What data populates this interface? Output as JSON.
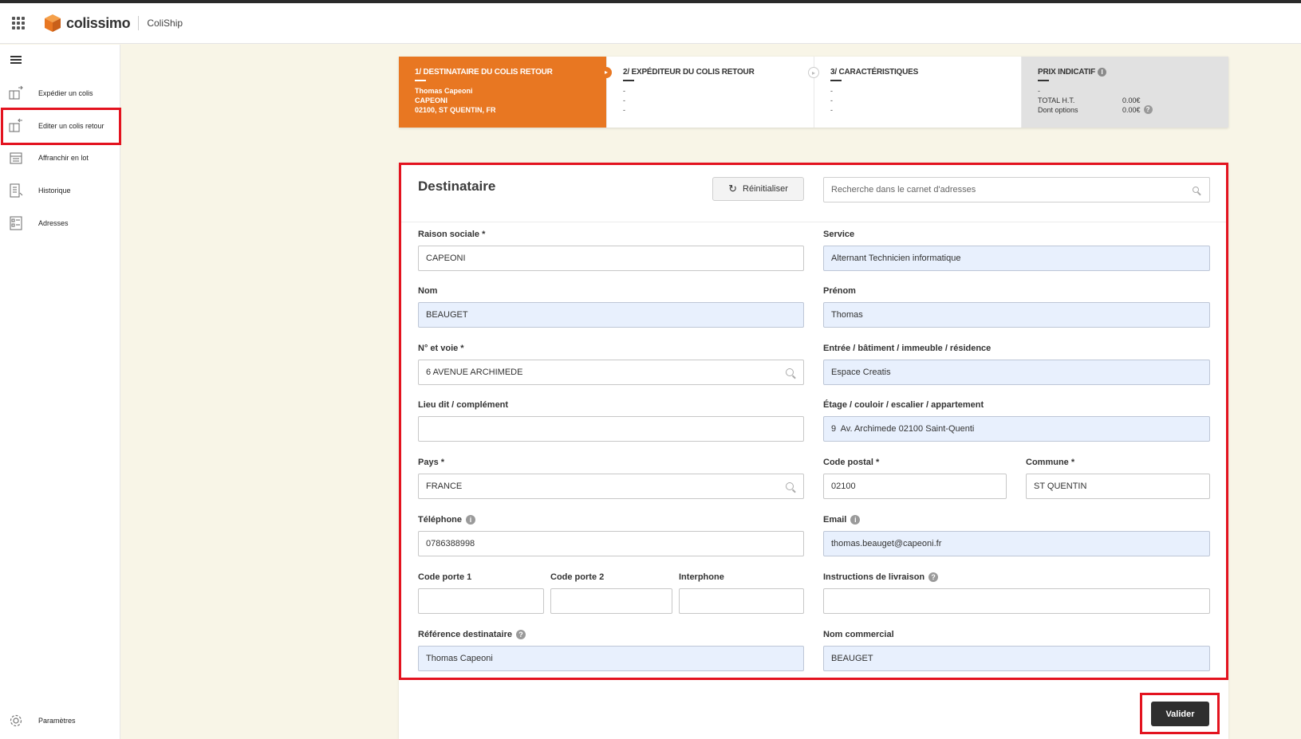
{
  "header": {
    "brand": "colissimo",
    "app_name": "ColiShip"
  },
  "sidebar": {
    "items": [
      {
        "label": "Expédier un colis",
        "icon": "send-parcel-icon"
      },
      {
        "label": "Editer un colis retour",
        "icon": "return-parcel-icon",
        "active": true
      },
      {
        "label": "Affranchir en lot",
        "icon": "batch-postage-icon"
      },
      {
        "label": "Historique",
        "icon": "history-icon"
      },
      {
        "label": "Adresses",
        "icon": "addresses-icon"
      }
    ],
    "settings_label": "Paramètres"
  },
  "stepper": {
    "step1": {
      "title": "1/ DESTINATAIRE DU COLIS RETOUR",
      "lines": [
        "Thomas Capeoni",
        "CAPEONI",
        "02100, ST QUENTIN, FR"
      ]
    },
    "step2": {
      "title": "2/ EXPÉDITEUR DU COLIS RETOUR",
      "lines": [
        "-",
        "-",
        "-"
      ]
    },
    "step3": {
      "title": "3/ CARACTÉRISTIQUES",
      "lines": [
        "-",
        "-",
        "-"
      ]
    },
    "price": {
      "title": "PRIX INDICATIF",
      "dash": "-",
      "total_label": "TOTAL H.T.",
      "total_value": "0.00€",
      "options_label": "Dont options",
      "options_value": "0.00€"
    }
  },
  "form": {
    "title": "Destinataire",
    "reset_label": "Réinitialiser",
    "search_placeholder": "Recherche dans le carnet d'adresses",
    "fields": {
      "raison_sociale": {
        "label": "Raison sociale *",
        "value": "CAPEONI"
      },
      "service": {
        "label": "Service",
        "value": "Alternant Technicien informatique"
      },
      "nom": {
        "label": "Nom",
        "value": "BEAUGET"
      },
      "prenom": {
        "label": "Prénom",
        "value": "Thomas"
      },
      "voie": {
        "label": "N° et voie *",
        "value": "6 AVENUE ARCHIMEDE"
      },
      "entree": {
        "label": "Entrée / bâtiment / immeuble / résidence",
        "value": "Espace Creatis"
      },
      "lieu_dit": {
        "label": "Lieu dit / complément",
        "value": ""
      },
      "etage": {
        "label": "Étage / couloir / escalier / appartement",
        "value": "9  Av. Archimede 02100 Saint-Quenti"
      },
      "pays": {
        "label": "Pays *",
        "value": "FRANCE"
      },
      "code_postal": {
        "label": "Code postal *",
        "value": "02100"
      },
      "commune": {
        "label": "Commune *",
        "value": "ST QUENTIN"
      },
      "telephone": {
        "label": "Téléphone",
        "value": "0786388998"
      },
      "email": {
        "label": "Email",
        "value": "thomas.beauget@capeoni.fr"
      },
      "code_porte_1": {
        "label": "Code porte 1",
        "value": ""
      },
      "code_porte_2": {
        "label": "Code porte 2",
        "value": ""
      },
      "interphone": {
        "label": "Interphone",
        "value": ""
      },
      "instructions": {
        "label": "Instructions de livraison",
        "value": ""
      },
      "reference": {
        "label": "Référence destinataire",
        "value": "Thomas Capeoni"
      },
      "nom_commercial": {
        "label": "Nom commercial",
        "value": "BEAUGET"
      }
    },
    "submit_label": "Valider"
  },
  "colors": {
    "accent_orange": "#e87722",
    "highlight_red": "#e3131f",
    "autofill_blue": "#e8f0fd",
    "page_bg": "#f8f5e7"
  }
}
